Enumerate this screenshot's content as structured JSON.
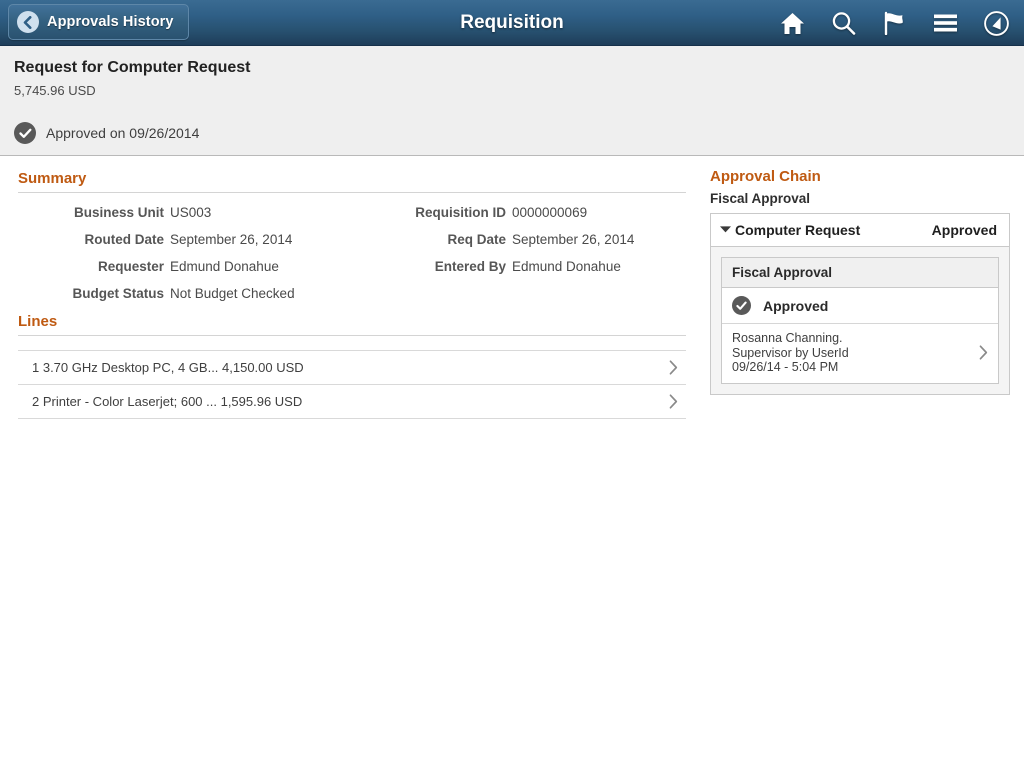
{
  "header": {
    "back_label": "Approvals History",
    "title": "Requisition",
    "icons": [
      {
        "name": "home-icon"
      },
      {
        "name": "search-icon"
      },
      {
        "name": "flag-icon"
      },
      {
        "name": "hamburger-menu-icon"
      },
      {
        "name": "navbar-compass-icon"
      }
    ]
  },
  "subheader": {
    "request_title": "Request for Computer Request",
    "amount": "5,745.96 USD",
    "status": "Approved on 09/26/2014"
  },
  "summary": {
    "heading": "Summary",
    "left_fields": [
      {
        "label": "Business Unit",
        "value": "US003"
      },
      {
        "label": "Routed Date",
        "value": "September 26, 2014"
      },
      {
        "label": "Requester",
        "value": "Edmund Donahue"
      },
      {
        "label": "Budget Status",
        "value": "Not Budget Checked"
      }
    ],
    "right_fields": [
      {
        "label": "Requisition ID",
        "value": "0000000069"
      },
      {
        "label": "Req Date",
        "value": "September 26, 2014"
      },
      {
        "label": "Entered By",
        "value": "Edmund Donahue"
      }
    ]
  },
  "lines": {
    "heading": "Lines",
    "items": [
      {
        "text": "1 3.70 GHz Desktop PC, 4 GB... 4,150.00 USD"
      },
      {
        "text": "2 Printer - Color Laserjet; 600 ...  1,595.96 USD"
      }
    ]
  },
  "approval_chain": {
    "heading": "Approval Chain",
    "stage_label": "Fiscal Approval",
    "panel": {
      "title": "Computer Request",
      "status": "Approved"
    },
    "card": {
      "title": "Fiscal Approval",
      "status": "Approved",
      "person_name": "Rosanna Channing.",
      "person_role": "Supervisor by UserId",
      "person_date": "09/26/14 - 5:04 PM"
    }
  },
  "colors": {
    "header_blue_top": "#3a6b92",
    "header_blue_bottom": "#1e3d59",
    "accent_orange": "#bf5a12",
    "status_gray": "#595959",
    "subheader_bg": "#efefef"
  }
}
